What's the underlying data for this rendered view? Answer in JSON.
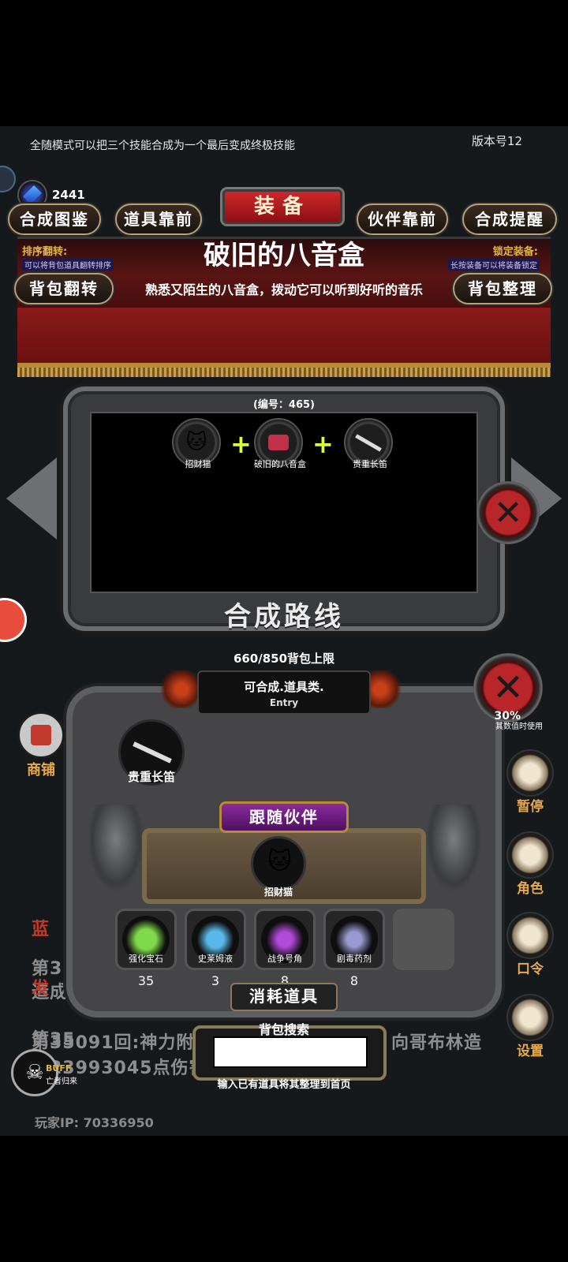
{
  "topbar": {
    "tip": "全随模式可以把三个技能合成为一个最后变成终极技能",
    "version": "版本号12"
  },
  "currency": {
    "gem_count": "2441",
    "icon": "blue-gem-icon"
  },
  "header": {
    "title": "装备",
    "buttons": [
      "合成图鉴",
      "道具靠前",
      "伙伴靠前",
      "合成提醒"
    ],
    "sort_label": "排序翻转:",
    "sort_desc": "可以将背包道具翻转排序",
    "lock_label": "锁定装备:",
    "lock_desc": "长按装备可以将装备锁定",
    "bag_flip": "背包翻转",
    "bag_sort": "背包整理"
  },
  "item": {
    "name": "破旧的八音盒",
    "description": "熟悉又陌生的八音盒，拨动它可以听到好听的音乐"
  },
  "recipe": {
    "id_label": "(编号：465)",
    "ingredients": [
      {
        "name": "招财猫",
        "icon": "lucky-cat-icon"
      },
      {
        "name": "破旧的八音盒",
        "icon": "music-box-icon"
      },
      {
        "name": "贵重长笛",
        "icon": "flute-icon"
      }
    ],
    "plus": "+",
    "route_label": "合成路线"
  },
  "bag": {
    "capacity": "660/850背包上限",
    "filter": "可合成.道具类.",
    "filter_sub": "Entry",
    "slot_item": "贵重长笛"
  },
  "companion": {
    "tab": "跟随伙伴",
    "name": "招财猫"
  },
  "consumables": {
    "title": "消耗道具",
    "items": [
      {
        "name": "强化宝石",
        "count": "35",
        "icon": "green-gem-icon"
      },
      {
        "name": "史莱姆液",
        "count": "3",
        "icon": "potion-bottle-icon"
      },
      {
        "name": "战争号角",
        "count": "8",
        "icon": "war-horn-icon"
      },
      {
        "name": "剧毒药剂",
        "count": "8",
        "icon": "poison-flask-icon"
      },
      {
        "name": "",
        "count": "",
        "icon": ""
      }
    ]
  },
  "search": {
    "label": "背包搜索",
    "value": "",
    "hint": "输入已有道具将其整理到首页"
  },
  "side_menu": {
    "pause": "暂停",
    "role": "角色",
    "code": "口令",
    "settings": "设置",
    "pct_value": "30%",
    "pct_label": "其数值时使用"
  },
  "shop": {
    "label": "商铺"
  },
  "buff": {
    "label": "BUFF",
    "sub": "亡者归来"
  },
  "log": {
    "line1": "蓝",
    "line2": "第35",
    "line3": "造成",
    "line4": "第35",
    "line5": "发",
    "line6": "第35091回:神力附",
    "line6b": "向哥布林造",
    "line7": "成23993045点伤害",
    "player_ip": "玩家IP: 70336950"
  }
}
